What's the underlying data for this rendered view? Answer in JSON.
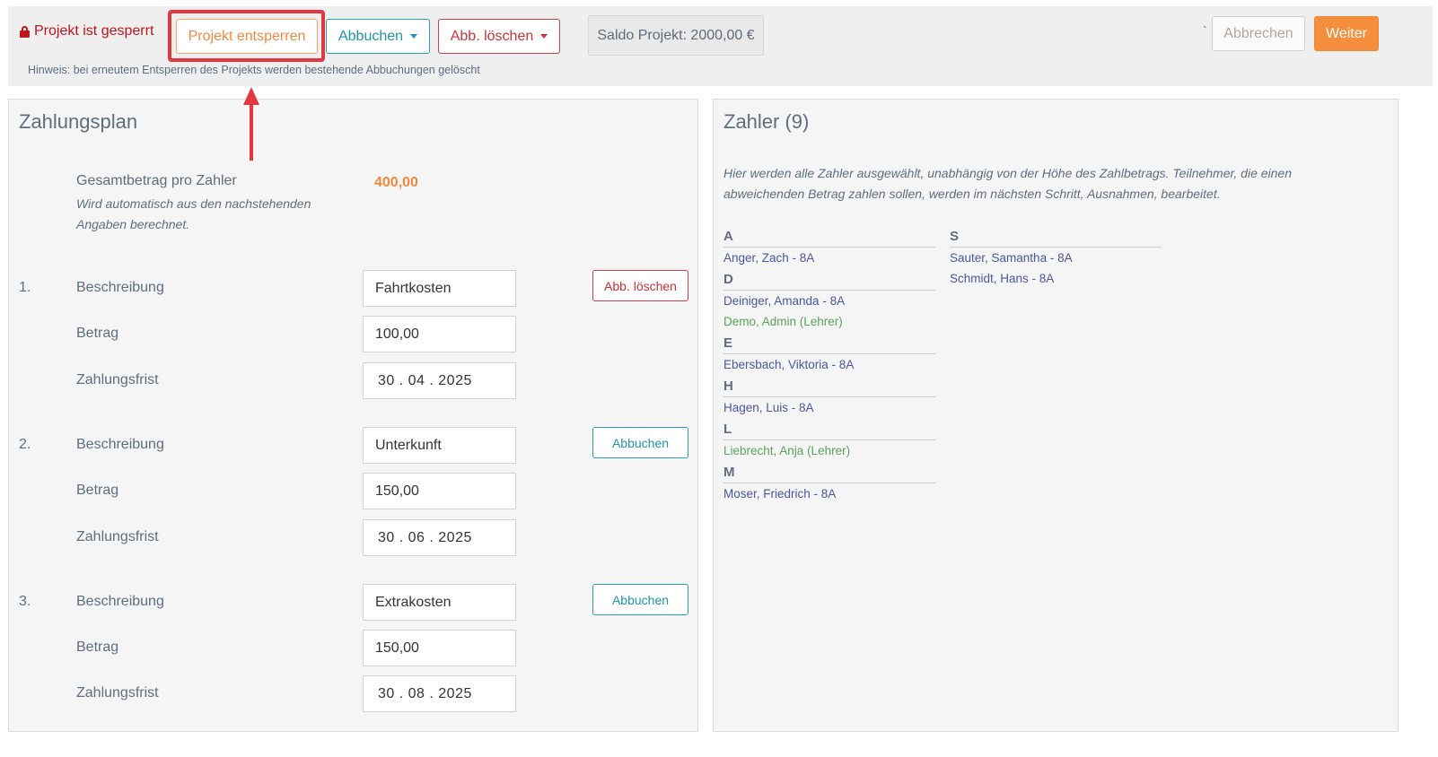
{
  "header": {
    "locked_text": "Projekt ist gesperrt",
    "unlock_label": "Projekt entsperren",
    "book_label": "Abbuchen",
    "delete_label": "Abb. löschen",
    "saldo": "Saldo Projekt: 2000,00 €",
    "tick": "`",
    "cancel_label": "Abbrechen",
    "next_label": "Weiter",
    "hint": "Hinweis: bei erneutem Entsperren des Projekts werden bestehende Abbuchungen gelöscht"
  },
  "plan": {
    "title": "Zahlungsplan",
    "total_label": "Gesamtbetrag pro Zahler",
    "total_note": "Wird automatisch aus den nachstehenden Angaben berechnet.",
    "total_value": "400,00",
    "items": [
      {
        "num": "1.",
        "desc_label": "Beschreibung",
        "desc": "Fahrtkosten",
        "amount_label": "Betrag",
        "amount": "100,00",
        "due_label": "Zahlungsfrist",
        "due": "30 . 04 . 2025",
        "action": "Abb. löschen"
      },
      {
        "num": "2.",
        "desc_label": "Beschreibung",
        "desc": "Unterkunft",
        "amount_label": "Betrag",
        "amount": "150,00",
        "due_label": "Zahlungsfrist",
        "due": "30 . 06 . 2025",
        "action": "Abbuchen"
      },
      {
        "num": "3.",
        "desc_label": "Beschreibung",
        "desc": "Extrakosten",
        "amount_label": "Betrag",
        "amount": "150,00",
        "due_label": "Zahlungsfrist",
        "due": "30 . 08 . 2025",
        "action": "Abbuchen"
      }
    ]
  },
  "payers": {
    "title": "Zahler (9)",
    "intro": "Hier werden alle Zahler ausgewählt, unabhängig von der Höhe des Zahlbetrags. Teilnehmer, die einen abweichenden Betrag zahlen sollen, werden im nächsten Schritt, Ausnahmen, bearbeitet.",
    "groups": [
      {
        "letter": "A",
        "names": [
          "Anger, Zach - 8A"
        ]
      },
      {
        "letter": "D",
        "names": [
          "Deiniger, Amanda - 8A",
          "Demo, Admin (Lehrer)"
        ]
      },
      {
        "letter": "E",
        "names": [
          "Ebersbach, Viktoria - 8A"
        ]
      },
      {
        "letter": "H",
        "names": [
          "Hagen, Luis - 8A"
        ]
      },
      {
        "letter": "L",
        "names": [
          "Liebrecht, Anja (Lehrer)"
        ]
      },
      {
        "letter": "M",
        "names": [
          "Moser, Friedrich - 8A"
        ]
      },
      {
        "letter": "S",
        "names": [
          "Sauter, Samantha - 8A",
          "Schmidt, Hans - 8A"
        ]
      }
    ]
  },
  "colors": {
    "accent_orange": "#f68f3d",
    "danger_red": "#c8323b",
    "info_teal": "#1f96ab",
    "payer_blue": "#4b56a0",
    "teacher_green": "#5aa35a"
  }
}
